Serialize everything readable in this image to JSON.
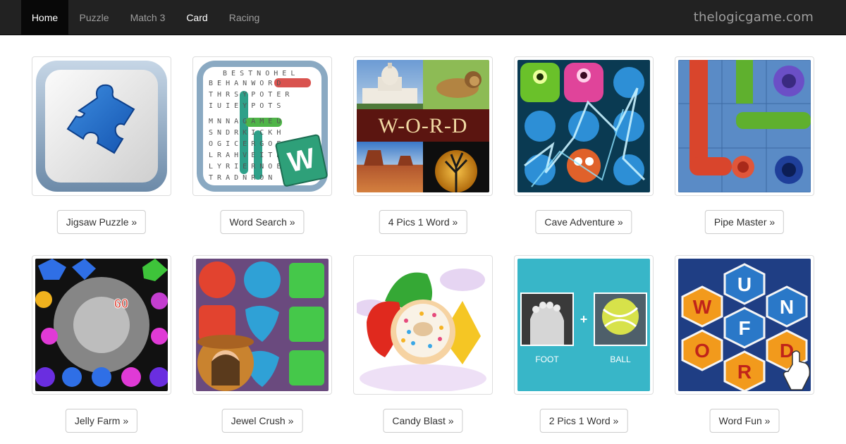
{
  "nav": {
    "items": [
      {
        "label": "Home"
      },
      {
        "label": "Puzzle"
      },
      {
        "label": "Match 3"
      },
      {
        "label": "Card"
      },
      {
        "label": "Racing"
      }
    ],
    "brand": "thelogicgame.com"
  },
  "games": [
    {
      "label": "Jigsaw Puzzle »",
      "icon": "jigsaw-piece-icon"
    },
    {
      "label": "Word Search »",
      "icon": "word-search-grid-icon",
      "grid_letters": [
        "BESTNOHEL",
        "BEHANWORD",
        "THRSYPOTER",
        "IUIEYPOTS",
        "MNNAGAMEU",
        "SNDRKICKH",
        "OGICERGOE",
        "LRAHVEITH",
        "LYRIERNOE",
        "TRADNRON"
      ],
      "badge": "W"
    },
    {
      "label": "4 Pics 1 Word »",
      "icon": "four-pics-icon",
      "banner": "W-O-R-D"
    },
    {
      "label": "Cave Adventure »",
      "icon": "cave-monsters-icon"
    },
    {
      "label": "Pipe Master »",
      "icon": "pipes-icon"
    },
    {
      "label": "Jelly Farm »",
      "icon": "jelly-gems-icon",
      "score": "60"
    },
    {
      "label": "Jewel Crush »",
      "icon": "jewel-crush-icon"
    },
    {
      "label": "Candy Blast »",
      "icon": "candy-donut-icon"
    },
    {
      "label": "2 Pics 1 Word »",
      "icon": "two-pics-icon",
      "left_caption": "FOOT",
      "right_caption": "BALL",
      "plus": "+"
    },
    {
      "label": "Word Fun »",
      "icon": "word-hexagons-icon",
      "letters": [
        "U",
        "W",
        "N",
        "F",
        "O",
        "D",
        "R"
      ]
    }
  ]
}
